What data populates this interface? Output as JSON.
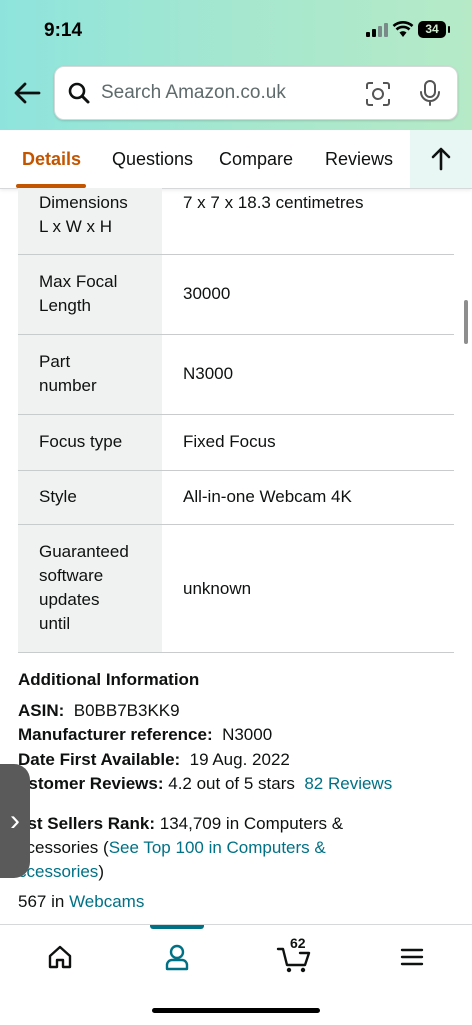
{
  "status": {
    "time": "9:14",
    "battery": "34"
  },
  "search": {
    "placeholder": "Search Amazon.co.uk"
  },
  "tabs": [
    "Details",
    "Questions",
    "Compare",
    "Reviews"
  ],
  "specs": [
    {
      "key": "Dimensions\nL x W x H",
      "value": "7 x 7 x 18.3 centimetres"
    },
    {
      "key": "Max Focal\nLength",
      "value": "30000"
    },
    {
      "key": "Part\nnumber",
      "value": "N3000"
    },
    {
      "key": "Focus type",
      "value": "Fixed Focus"
    },
    {
      "key": "Style",
      "value": "All-in-one Webcam 4K"
    },
    {
      "key": "Guaranteed\nsoftware\nupdates\nuntil",
      "value": "unknown"
    }
  ],
  "additional": {
    "heading": "Additional Information",
    "asin_label": "ASIN:",
    "asin_value": "B0BB7B3KK9",
    "manufacturer_label": "Manufacturer reference:",
    "manufacturer_value": "N3000",
    "date_label": "Date First Available:",
    "date_value": "19 Aug. 2022",
    "reviews_label": "ustomer Reviews:",
    "reviews_value": "4.2 out of 5 stars",
    "reviews_link": "82  Reviews",
    "rank_label": "est Sellers Rank:",
    "rank_value": "134,709 in Computers &",
    "rank_line2_prefix": "ccessories (",
    "rank_link_a": "See Top 100 in Computers &",
    "rank_link_b": "ccessories",
    "rank_line3_suffix": ")",
    "sub_rank_value": "567 in",
    "sub_rank_link": "Webcams"
  },
  "bottom_nav": {
    "cart_count": "62"
  },
  "colors": {
    "accent": "#c45500",
    "link": "#007185",
    "header_gradient_start": "#8ee4dd",
    "header_gradient_end": "#b6eac7"
  }
}
